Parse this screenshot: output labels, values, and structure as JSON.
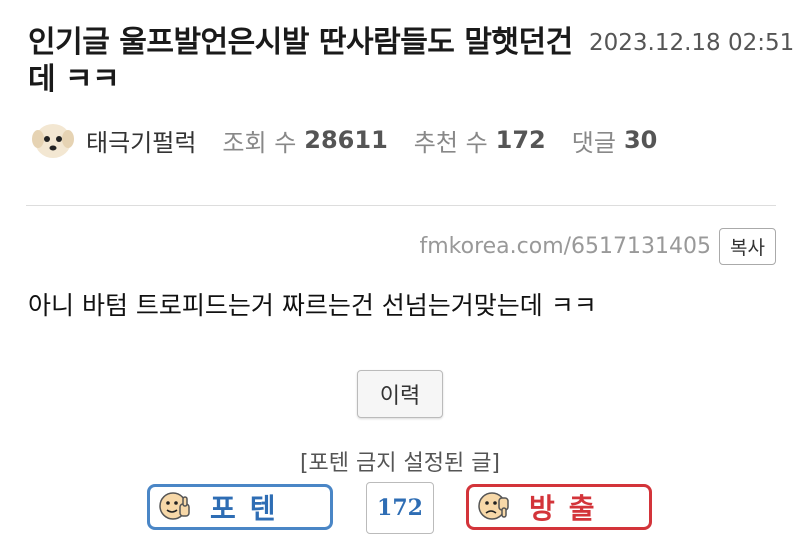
{
  "post": {
    "title": "인기글 울프발언은시발 딴사람들도 말햇던건데 ㅋㅋ",
    "date": "2023.12.18 02:51",
    "author": "태극기펄럭",
    "views_label": "조회 수",
    "views": "28611",
    "recommend_label": "추천 수",
    "recommend": "172",
    "comments_label": "댓글",
    "comments": "30",
    "url": "fmkorea.com/6517131405",
    "copy_label": "복사",
    "body": "아니 바텀 트로피드는거 짜르는건 선넘는거맞는데 ㅋㅋ"
  },
  "actions": {
    "history_label": "이력",
    "notice": "[포텐 금지 설정된 글]",
    "upvote_label": "포텐",
    "vote_count": "172",
    "downvote_label": "방출"
  },
  "colors": {
    "upvote": "#4a86c6",
    "downvote": "#d3343a"
  },
  "icons": {
    "avatar": "dog-avatar-icon",
    "upvote": "thumbs-up-face-icon",
    "downvote": "thumbs-down-face-icon"
  }
}
